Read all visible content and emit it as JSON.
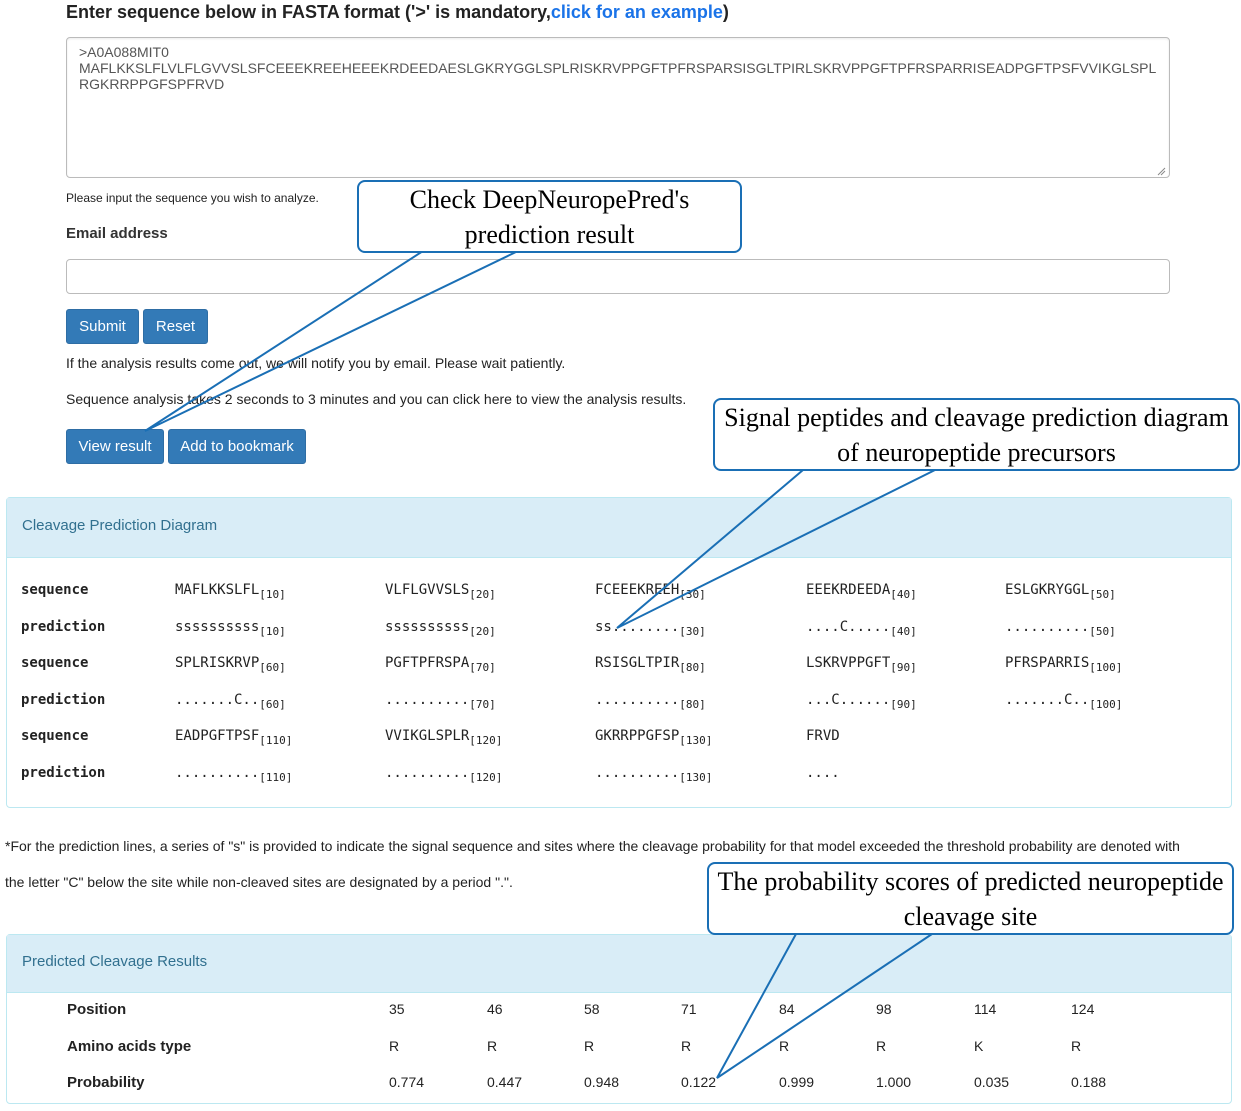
{
  "form": {
    "heading_text": "Enter sequence below in FASTA format ('>' is mandatory,",
    "heading_link": "click for an example",
    "heading_close": ")",
    "sequence_value": ">A0A088MIT0\nMAFLKKSLFLVLFLGVVSLSFCEEEKREEHEEEKRDEEDAESLGKRYGGLSPLRISKRVPPGFTPFRSPARSISGLTPIRLSKRVPPGFTPFRSPARRISEADPGFTPSFVVIKGLSPLRGKRRPPGFSPFRVD",
    "help_text": "Please input the sequence you wish to analyze.",
    "email_label": "Email address",
    "email_value": "",
    "submit_label": "Submit",
    "reset_label": "Reset",
    "notify_text": "If the analysis results come out, we will notify you by email. Please wait patiently.",
    "duration_text": "Sequence analysis takes 2 seconds to 3 minutes and you can click here to view the analysis results.",
    "view_result_label": "View result",
    "bookmark_label": "Add to bookmark"
  },
  "diagram": {
    "title": "Cleavage Prediction Diagram",
    "rows": [
      {
        "label": "sequence",
        "cells": [
          [
            "MAFLKKSLFL",
            "[10]"
          ],
          [
            "VLFLGVVSLS",
            "[20]"
          ],
          [
            "FCEEEKREEH",
            "[30]"
          ],
          [
            "EEEKRDEEDA",
            "[40]"
          ],
          [
            "ESLGKRYGGL",
            "[50]"
          ]
        ]
      },
      {
        "label": "prediction",
        "cells": [
          [
            "ssssssssss",
            "[10]"
          ],
          [
            "ssssssssss",
            "[20]"
          ],
          [
            "ss........",
            "[30]"
          ],
          [
            "....C.....",
            "[40]"
          ],
          [
            "..........",
            "[50]"
          ]
        ]
      },
      {
        "label": "sequence",
        "cells": [
          [
            "SPLRISKRVP",
            "[60]"
          ],
          [
            "PGFTPFRSPA",
            "[70]"
          ],
          [
            "RSISGLTPIR",
            "[80]"
          ],
          [
            "LSKRVPPGFT",
            "[90]"
          ],
          [
            "PFRSPARRIS",
            "[100]"
          ]
        ]
      },
      {
        "label": "prediction",
        "cells": [
          [
            ".......C..",
            "[60]"
          ],
          [
            "..........",
            "[70]"
          ],
          [
            "..........",
            "[80]"
          ],
          [
            "...C......",
            "[90]"
          ],
          [
            ".......C..",
            "[100]"
          ]
        ]
      },
      {
        "label": "sequence",
        "cells": [
          [
            "EADPGFTPSF",
            "[110]"
          ],
          [
            "VVIKGLSPLR",
            "[120]"
          ],
          [
            "GKRRPPGFSP",
            "[130]"
          ],
          [
            "FRVD",
            ""
          ]
        ]
      },
      {
        "label": "prediction",
        "cells": [
          [
            "..........",
            "[110]"
          ],
          [
            "..........",
            "[120]"
          ],
          [
            "..........",
            "[130]"
          ],
          [
            "....",
            ""
          ]
        ]
      }
    ]
  },
  "footnote": {
    "line1": "*For the prediction lines, a series of \"s\" is provided to indicate the signal sequence and sites where the cleavage probability for that model exceeded the threshold probability are denoted with",
    "line2": "the letter \"C\" below the site while non-cleaved sites are designated by a period \".\"."
  },
  "results": {
    "title": "Predicted Cleavage Results",
    "rows": [
      {
        "label": "Position",
        "values": [
          "35",
          "46",
          "58",
          "71",
          "84",
          "98",
          "114",
          "124"
        ]
      },
      {
        "label": "Amino acids type",
        "values": [
          "R",
          "R",
          "R",
          "R",
          "R",
          "R",
          "K",
          "R"
        ]
      },
      {
        "label": "Probability",
        "values": [
          "0.774",
          "0.447",
          "0.948",
          "0.122",
          "0.999",
          "1.000",
          "0.035",
          "0.188"
        ]
      }
    ]
  },
  "callouts": {
    "result": "Check DeepNeuropePred's prediction result",
    "diagram": "Signal peptides and cleavage prediction diagram of neuropeptide precursors",
    "scores": "The probability scores of predicted neuropeptide cleavage site"
  },
  "colors": {
    "button": "#337ab7",
    "panel_header": "#d9edf7",
    "callout_border": "#1a6fb5",
    "link": "#1a73e8"
  }
}
